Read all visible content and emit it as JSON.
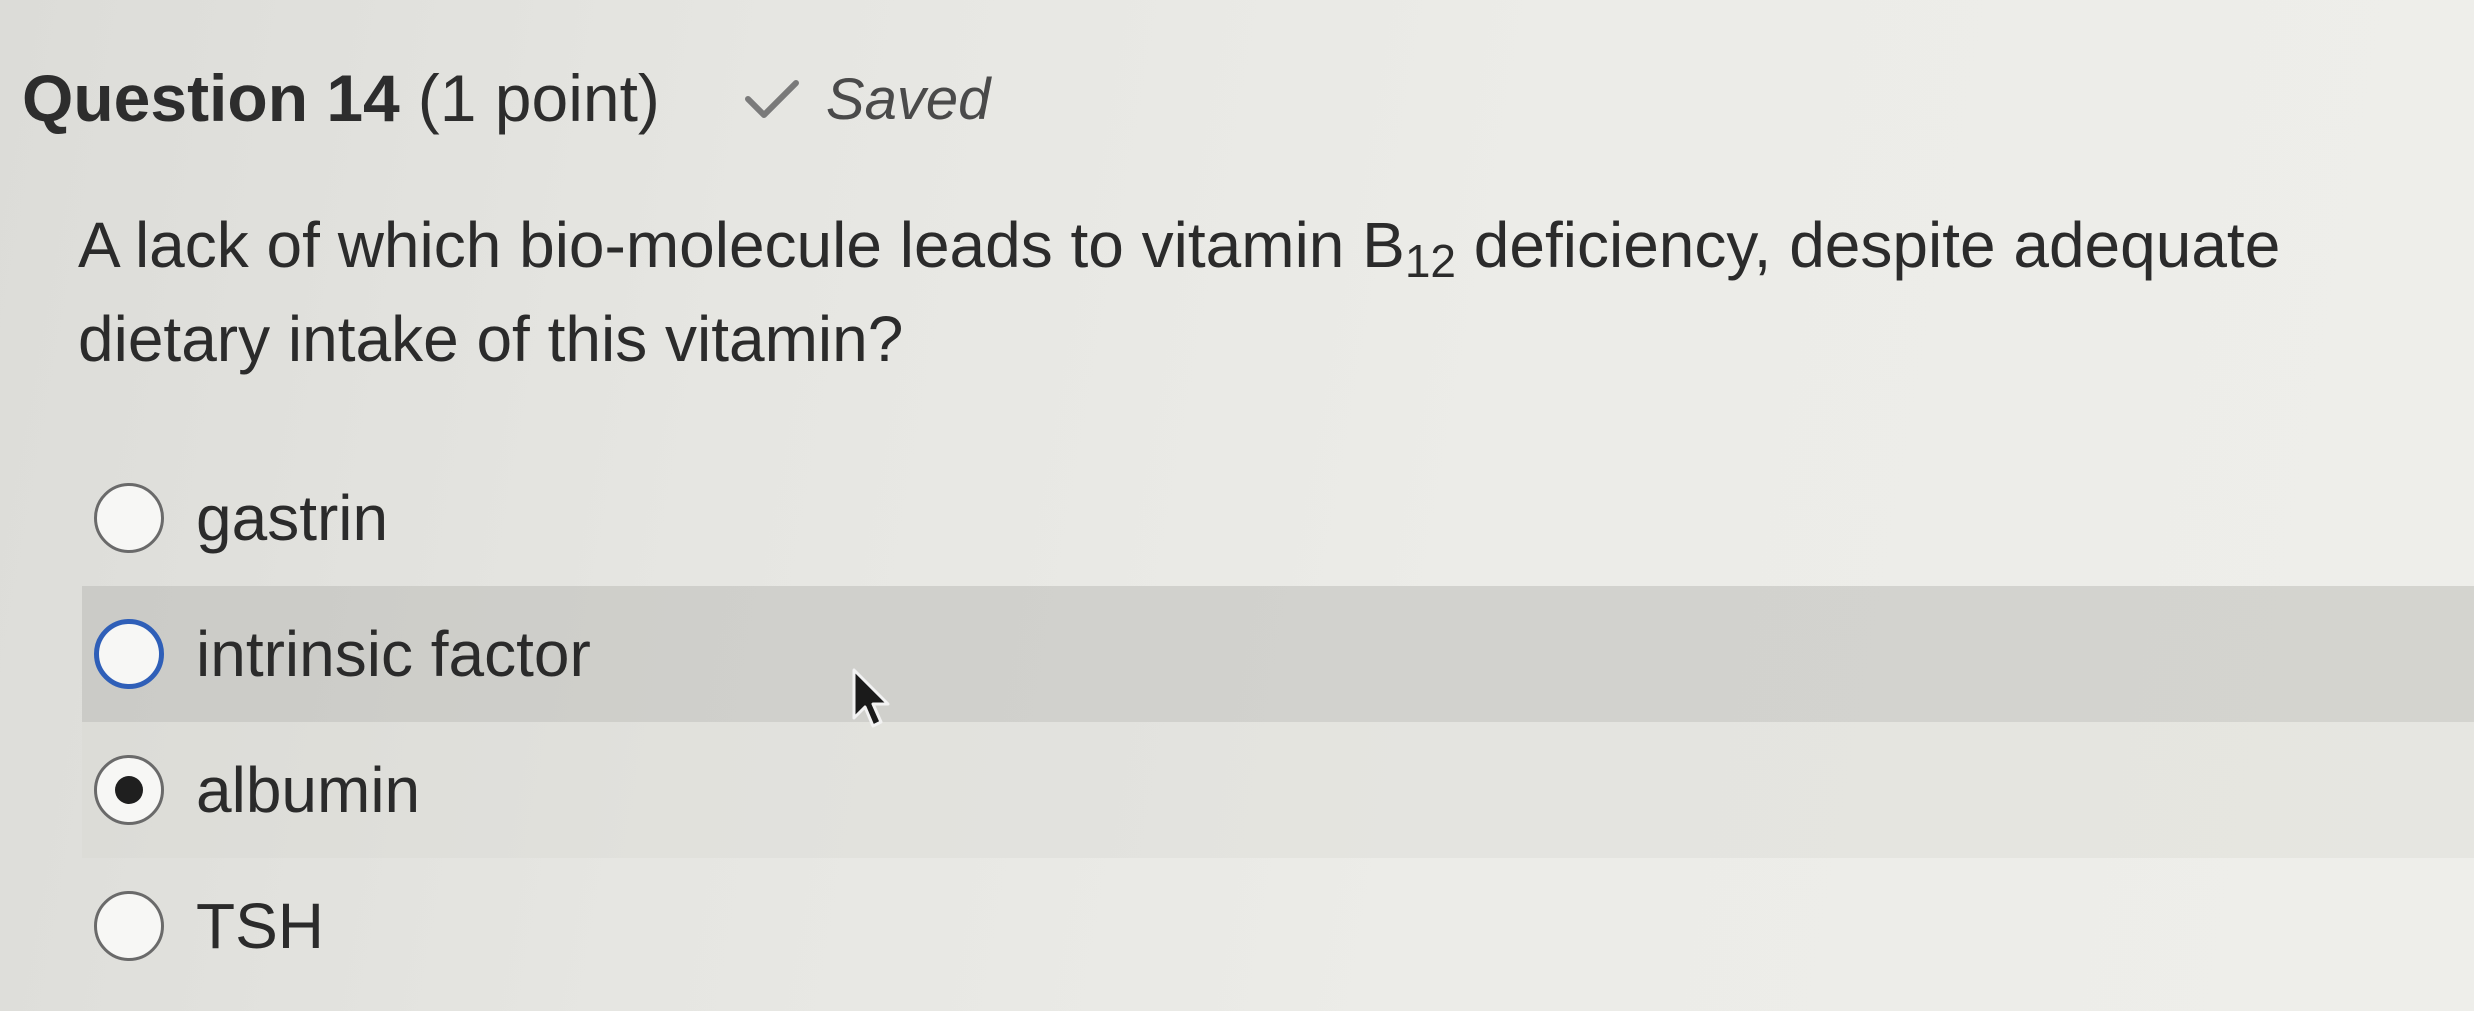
{
  "header": {
    "title": "Question 14",
    "points": "(1 point)",
    "status_icon": "check-icon",
    "status_label": "Saved"
  },
  "question": {
    "text_before": "A lack of which bio-molecule leads to vitamin B",
    "subscript": "12",
    "text_after": " deficiency, despite adequate dietary intake of this vitamin?"
  },
  "options": [
    {
      "label": "gastrin",
      "selected": false
    },
    {
      "label": "intrinsic factor",
      "selected": false
    },
    {
      "label": "albumin",
      "selected": true
    },
    {
      "label": "TSH",
      "selected": false
    }
  ],
  "colors": {
    "focus_ring": "#2f5fb8",
    "selected_dot": "#1f1f1f"
  }
}
